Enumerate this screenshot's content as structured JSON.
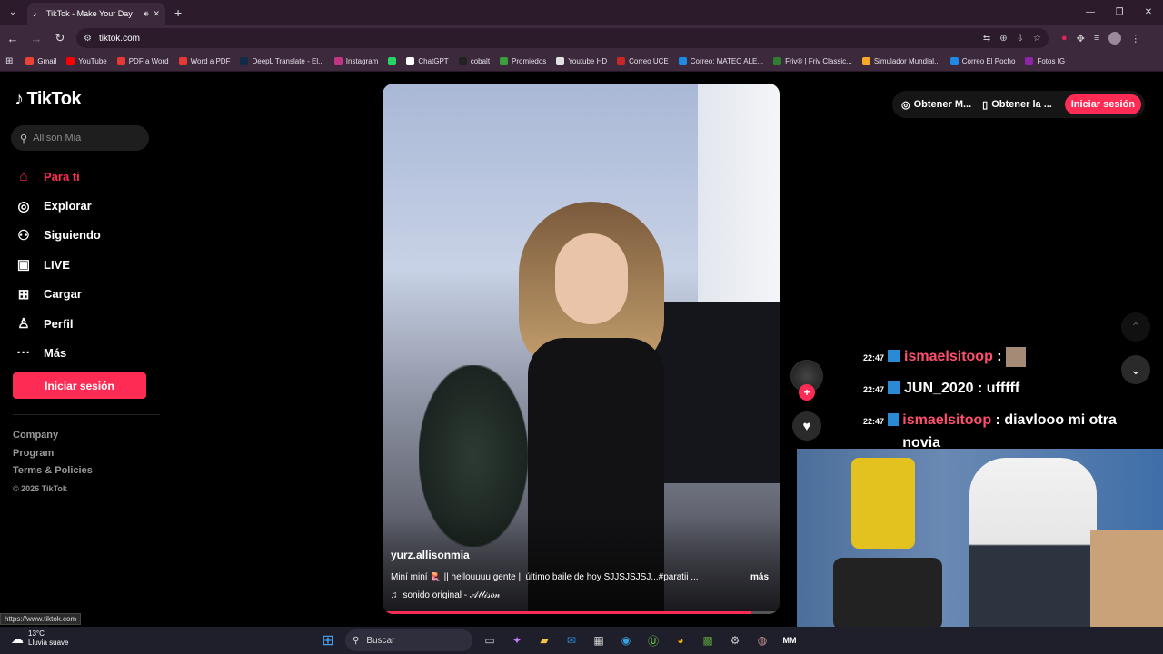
{
  "browser": {
    "tab_title": "TikTok - Make Your Day",
    "url": "tiktok.com",
    "status_url": "https://www.tiktok.com",
    "bookmarks": [
      {
        "label": "Gmail",
        "color": "#ea4335"
      },
      {
        "label": "YouTube",
        "color": "#ff0000"
      },
      {
        "label": "PDF a Word",
        "color": "#e53935"
      },
      {
        "label": "Word a PDF",
        "color": "#e53935"
      },
      {
        "label": "DeepL Translate - El...",
        "color": "#0f2b46"
      },
      {
        "label": "Instagram",
        "color": "#c13584"
      },
      {
        "label": "",
        "color": "#25d366"
      },
      {
        "label": "ChatGPT",
        "color": "#ffffff"
      },
      {
        "label": "cobalt",
        "color": "#222222"
      },
      {
        "label": "Promiedos",
        "color": "#3a9f3a"
      },
      {
        "label": "Youtube HD",
        "color": "#e0e0e0"
      },
      {
        "label": "Correo UCE",
        "color": "#c62828"
      },
      {
        "label": "Correo: MATEO ALE...",
        "color": "#1e88e5"
      },
      {
        "label": "Friv® | Friv Classic...",
        "color": "#2e7d32"
      },
      {
        "label": "Simulador Mundial...",
        "color": "#f9a825"
      },
      {
        "label": "Correo El Pocho",
        "color": "#1e88e5"
      },
      {
        "label": "Fotos IG",
        "color": "#8e24aa"
      }
    ]
  },
  "sidebar": {
    "logo": "TikTok",
    "search_placeholder": "Allison Mia",
    "nav": [
      {
        "label": "Para ti",
        "icon": "home-icon",
        "glyph": "⌂",
        "active": true
      },
      {
        "label": "Explorar",
        "icon": "compass-icon",
        "glyph": "◎",
        "active": false
      },
      {
        "label": "Siguiendo",
        "icon": "following-icon",
        "glyph": "⚇",
        "active": false
      },
      {
        "label": "LIVE",
        "icon": "live-icon",
        "glyph": "▣",
        "active": false
      },
      {
        "label": "Cargar",
        "icon": "upload-icon",
        "glyph": "⊞",
        "active": false
      },
      {
        "label": "Perfil",
        "icon": "profile-icon",
        "glyph": "♙",
        "active": false
      },
      {
        "label": "Más",
        "icon": "more-icon",
        "glyph": "···",
        "active": false
      }
    ],
    "login_label": "Iniciar sesión",
    "footer": [
      "Company",
      "Program",
      "Terms & Policies"
    ],
    "copyright": "© 2026 TikTok"
  },
  "video": {
    "username": "yurz.allisonmia",
    "caption": "Miní miní 🪼 || hellouuuu gente || último baile de hoy SJJSJSJSJ...#paratii ...",
    "more": "más",
    "sound": "sonido original - 𝒜𝓁𝓁𝒾𝓈𝑜𝓃",
    "progress": 0.93
  },
  "top_actions": {
    "get_app_1": "Obtener M...",
    "get_app_2": "Obtener la ...",
    "login": "Iniciar sesión"
  },
  "chat": [
    {
      "time": "22:47",
      "user": "ismaelsitoop",
      "sep": " :",
      "text": "",
      "pink": true,
      "emoji": true
    },
    {
      "time": "22:47",
      "user": "JUN_2020",
      "sep": " :",
      "text": " ufffff",
      "pink": false,
      "emoji": false
    },
    {
      "time": "22:47",
      "user": "ismaelsitoop",
      "sep": " :",
      "text": " diavlooo mi otra novia",
      "pink": true,
      "emoji": false
    }
  ],
  "taskbar": {
    "temp": "13°C",
    "weather": "Lluvia suave",
    "search": "Buscar"
  },
  "colors": {
    "accent": "#fe2c55",
    "chrome": "#3c2a3c"
  }
}
